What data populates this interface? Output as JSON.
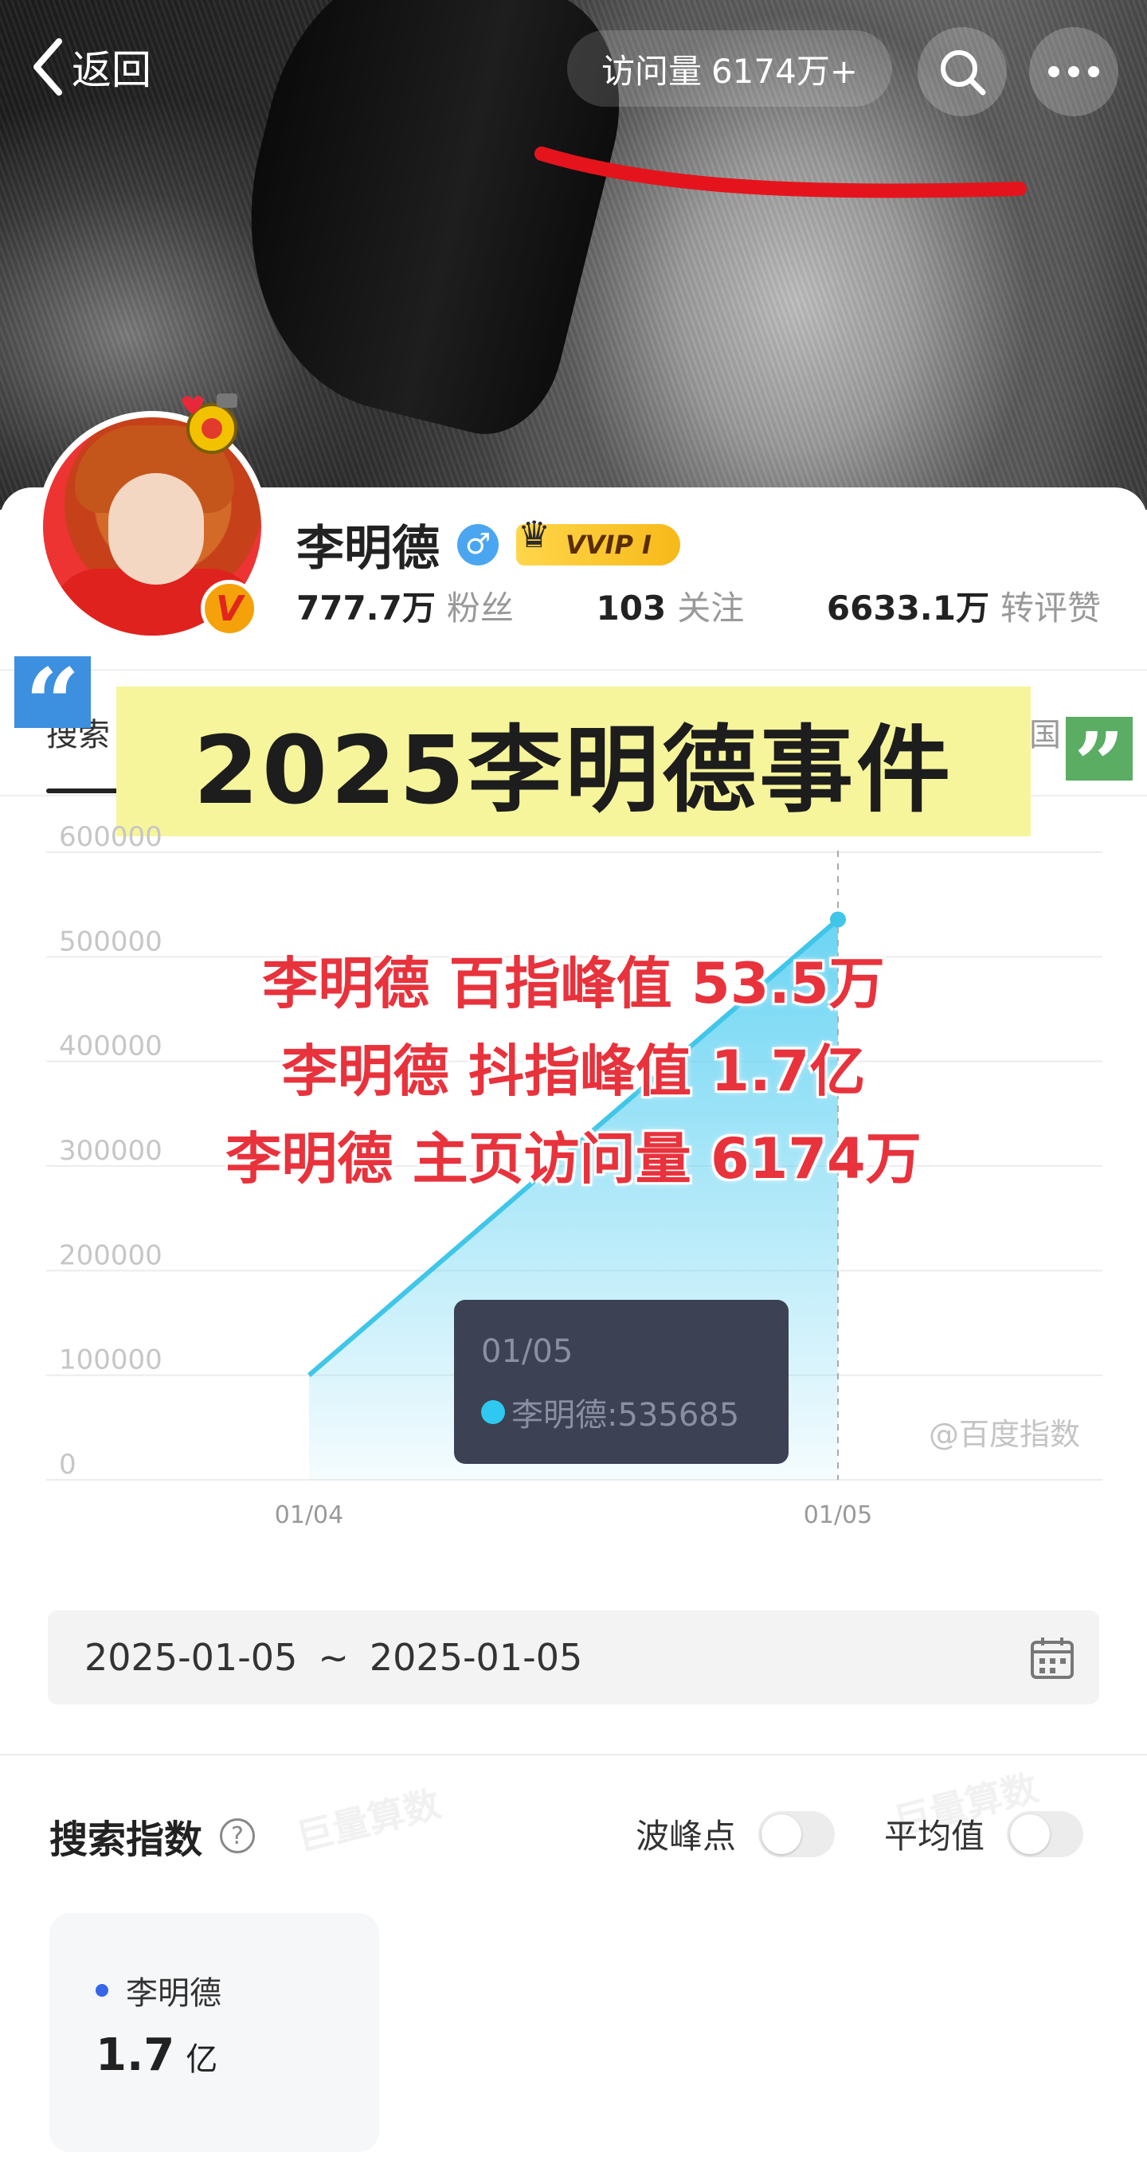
{
  "nav": {
    "back_label": "返回",
    "visits_label": "访问量",
    "visits_value": "6174万+"
  },
  "profile": {
    "name": "李明德",
    "vip_label": "VVIP I",
    "stats": [
      {
        "value": "777.7万",
        "label": "粉丝"
      },
      {
        "value": "103",
        "label": "关注"
      },
      {
        "value": "6633.1万",
        "label": "转评赞"
      }
    ]
  },
  "tabs": {
    "first": "搜索",
    "last": "国"
  },
  "banner": {
    "title": "2025李明德事件"
  },
  "overlay": {
    "lines": [
      "李明德 百指峰值 53.5万",
      "李明德 抖指峰值 1.7亿",
      "李明德 主页访问量 6174万"
    ]
  },
  "chart_data": {
    "type": "area",
    "categories": [
      "01/04",
      "01/05"
    ],
    "series": [
      {
        "name": "李明德",
        "values": [
          100000,
          535685
        ]
      }
    ],
    "ylim": [
      0,
      600000
    ],
    "yticks": [
      0,
      100000,
      200000,
      300000,
      400000,
      500000,
      600000
    ],
    "grid": true,
    "colors": {
      "line": "#3fc6e8",
      "fill_top": "#5bd0f2"
    },
    "tooltip": {
      "date": "01/05",
      "text": "李明德:535685"
    },
    "watermark": "@百度指数"
  },
  "date_range": {
    "start": "2025-01-05",
    "separator": "~",
    "end": "2025-01-05"
  },
  "search_index": {
    "title": "搜索指数",
    "toggle_peak": "波峰点",
    "toggle_avg": "平均值",
    "watermark": "巨量算数",
    "card": {
      "name": "李明德",
      "value": "1.7",
      "unit": "亿"
    }
  }
}
